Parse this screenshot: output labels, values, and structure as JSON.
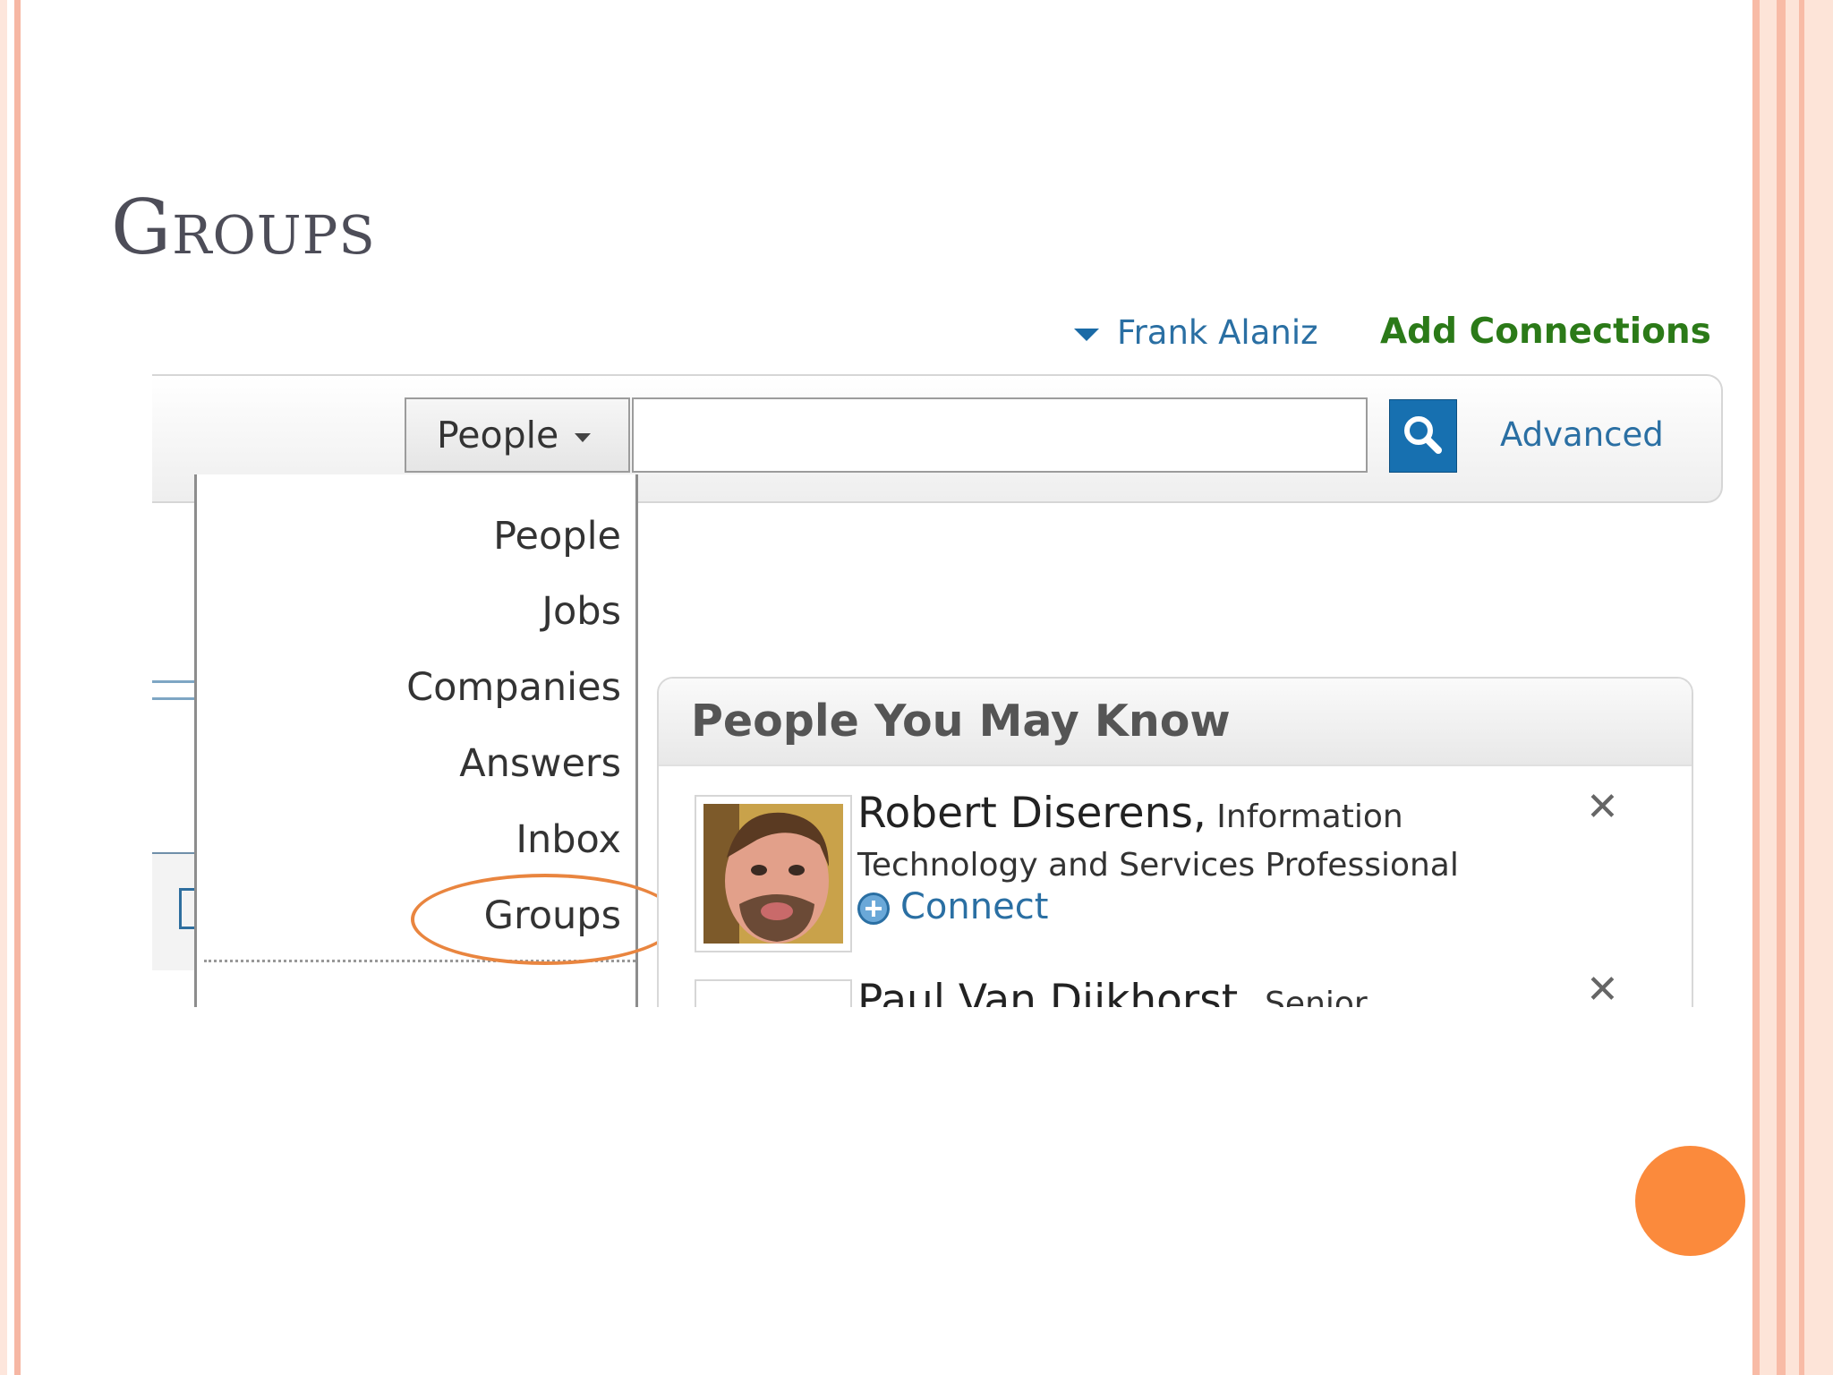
{
  "slide": {
    "title": "Groups"
  },
  "header": {
    "user_name": "Frank Alaniz",
    "add_connections": "Add Connections"
  },
  "search": {
    "selected_category": "People",
    "input_value": "",
    "advanced_label": "Advanced"
  },
  "dropdown": {
    "items": [
      "People",
      "Jobs",
      "Companies",
      "Answers",
      "Inbox",
      "Groups"
    ],
    "highlighted": "Groups"
  },
  "pymk": {
    "title": "People You May Know",
    "people": [
      {
        "name": "Robert Diserens,",
        "headline": "Information Technology and Services Professional",
        "action": "Connect"
      },
      {
        "name": "Paul Van Dijkhorst,",
        "headline": "Senior"
      }
    ],
    "dismiss_symbol": "✕"
  },
  "colors": {
    "link_blue": "#2a6fa3",
    "add_green": "#2b7a18",
    "highlight_orange": "#e9853f",
    "accent_dot": "#fb8a3c",
    "search_button": "#1770b0"
  }
}
